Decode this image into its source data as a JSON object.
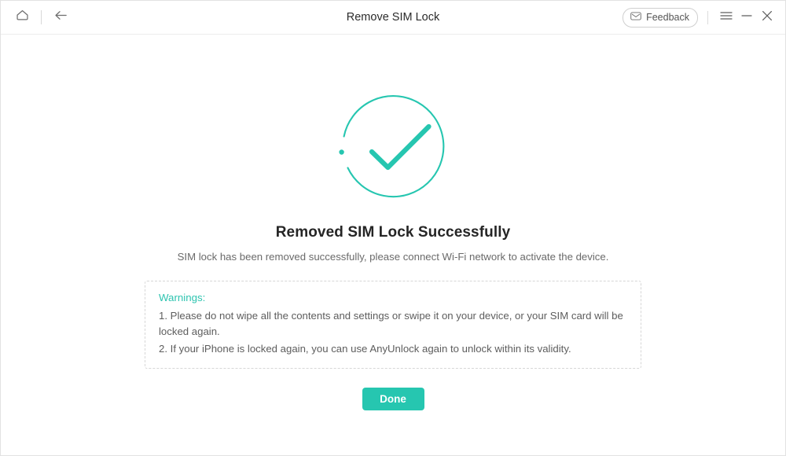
{
  "window": {
    "title": "Remove SIM Lock",
    "accent_color": "#26c6b0",
    "warning_accent_color": "#2ec4b0",
    "heading_color": "#252525",
    "body_text_color": "#5d5d5d"
  },
  "titlebar": {
    "home_icon": "home-icon",
    "back_icon": "back-arrow-icon",
    "feedback_label": "Feedback",
    "feedback_icon": "envelope-icon",
    "menu_icon": "hamburger-menu-icon",
    "minimize_icon": "minimize-icon",
    "close_icon": "close-icon"
  },
  "main": {
    "status_icon": "success-check-circle-icon",
    "heading": "Removed SIM Lock Successfully",
    "subtext": "SIM lock has been removed successfully, please connect Wi-Fi network to activate the device.",
    "warnings": {
      "title": "Warnings:",
      "items": [
        "1. Please do not wipe all the contents and settings or swipe it on your device, or your SIM card will be locked again.",
        "2. If your iPhone is locked again, you can use AnyUnlock again to unlock within its validity."
      ]
    },
    "primary_button": "Done"
  }
}
